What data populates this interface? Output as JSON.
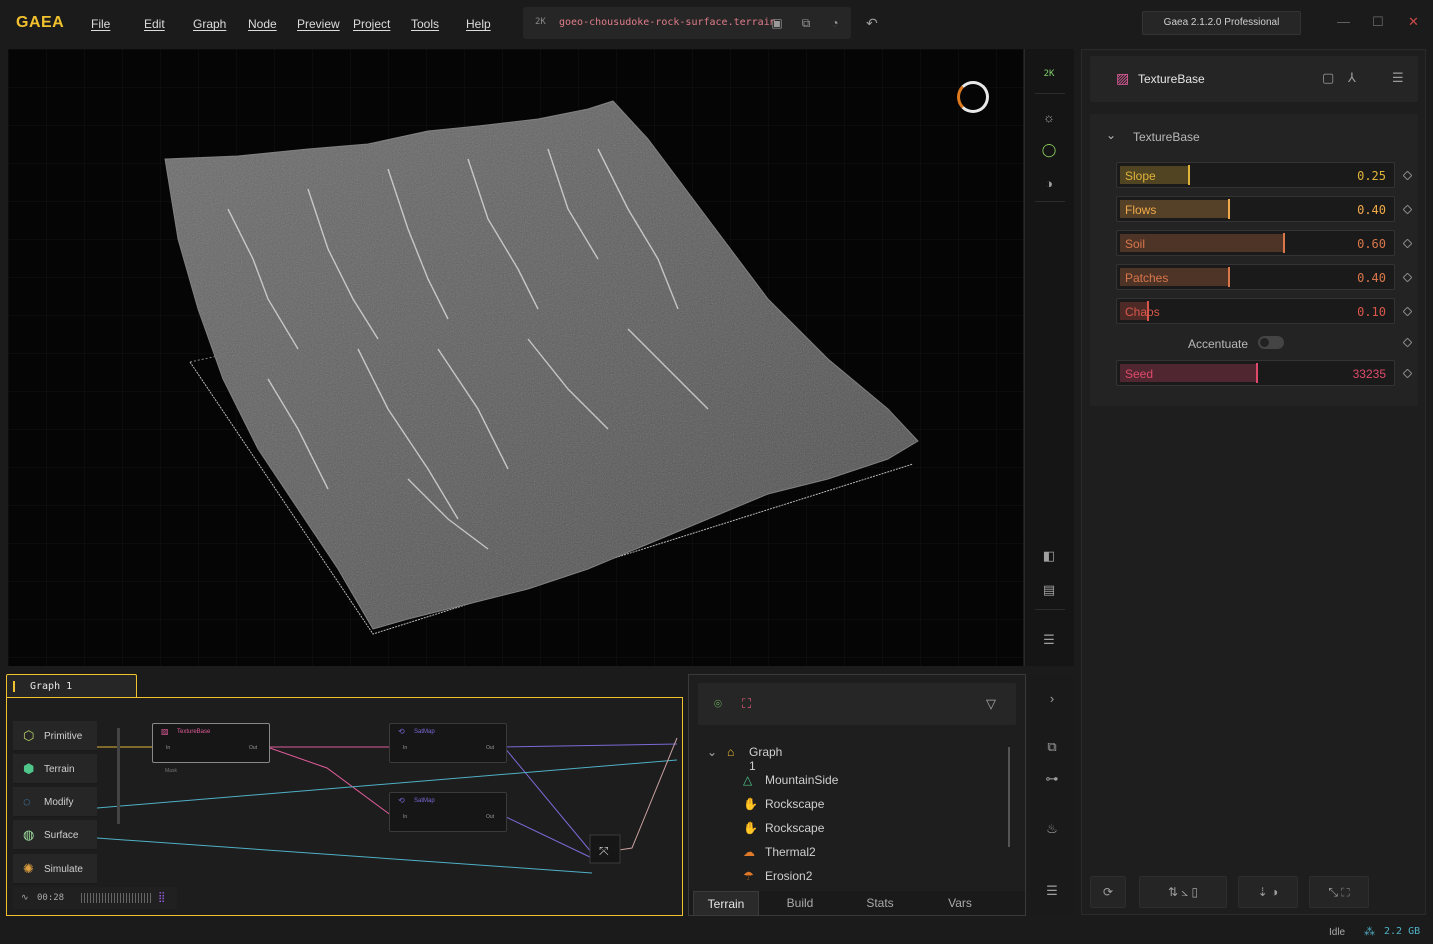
{
  "app": {
    "logo": "GAEA",
    "menu": [
      "File",
      "Edit",
      "Graph",
      "Node",
      "Preview",
      "Project",
      "Tools",
      "Help"
    ],
    "resolution_badge": "2K",
    "file_name": "goeo-chousudoke-rock-surface.terrain",
    "version": "Gaea 2.1.2.0 Professional"
  },
  "viewport": {
    "res_badge": "2K",
    "icons": [
      "resolution-icon",
      "sun-icon",
      "circle-icon",
      "half-circle-icon",
      "split-view-icon",
      "layers-icon",
      "list-icon"
    ]
  },
  "properties": {
    "node_title": "TextureBase",
    "section_title": "TextureBase",
    "params": [
      {
        "label": "Slope",
        "value": "0.25",
        "fraction": 0.25,
        "color": "#e0b43a"
      },
      {
        "label": "Flows",
        "value": "0.40",
        "fraction": 0.4,
        "color": "#f0a94a"
      },
      {
        "label": "Soil",
        "value": "0.60",
        "fraction": 0.6,
        "color": "#d9774a"
      },
      {
        "label": "Patches",
        "value": "0.40",
        "fraction": 0.4,
        "color": "#d9774a"
      },
      {
        "label": "Chaos",
        "value": "0.10",
        "fraction": 0.1,
        "color": "#d9574a"
      }
    ],
    "accentuate_label": "Accentuate",
    "accentuate_on": false,
    "seed": {
      "label": "Seed",
      "value": "33235",
      "fraction": 0.5,
      "color": "#e04a6a"
    }
  },
  "graph": {
    "tab_label": "Graph 1",
    "categories": [
      {
        "label": "Primitive",
        "icon": "cube-icon",
        "color": "#b7d66b"
      },
      {
        "label": "Terrain",
        "icon": "terrain-icon",
        "color": "#4fc68a"
      },
      {
        "label": "Modify",
        "icon": "modify-icon",
        "color": "#4fa0e0"
      },
      {
        "label": "Surface",
        "icon": "surface-icon",
        "color": "#a0e0a0"
      },
      {
        "label": "Simulate",
        "icon": "simulate-icon",
        "color": "#e0a040"
      }
    ],
    "nodes": [
      {
        "title": "TextureBase",
        "in": "In",
        "out": "Out",
        "extra": "Mask",
        "color": "#e05c9a"
      },
      {
        "title": "SatMap",
        "in": "In",
        "out": "Out",
        "color": "#7a6ad6"
      },
      {
        "title": "SatMap",
        "in": "In",
        "out": "Out",
        "color": "#7a6ad6"
      }
    ],
    "timeline_time": "00:28"
  },
  "explorer": {
    "root": "Graph 1",
    "items": [
      {
        "label": "MountainSide",
        "color": "#4fc68a",
        "icon": "mountain-icon"
      },
      {
        "label": "Rockscape",
        "color": "#cfcfcf",
        "icon": "rock-icon"
      },
      {
        "label": "Rockscape",
        "color": "#cfcfcf",
        "icon": "rock-icon"
      },
      {
        "label": "Thermal2",
        "color": "#e07a2a",
        "icon": "thermal-icon"
      },
      {
        "label": "Erosion2",
        "color": "#e07a2a",
        "icon": "erosion-icon"
      }
    ],
    "tabs": [
      "Terrain",
      "Build",
      "Stats",
      "Vars"
    ],
    "active_tab": "Terrain"
  },
  "status": {
    "state": "Idle",
    "memory": "2.2 GB"
  }
}
